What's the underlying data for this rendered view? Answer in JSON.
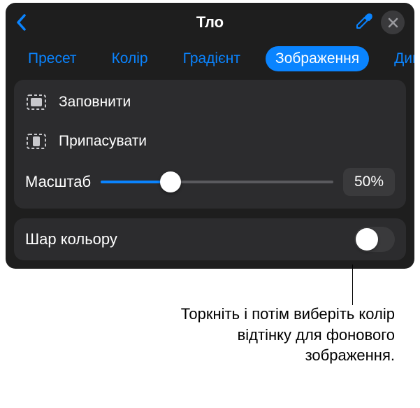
{
  "header": {
    "title": "Тло"
  },
  "tabs": {
    "items": [
      {
        "label": "Пресет"
      },
      {
        "label": "Колір"
      },
      {
        "label": "Градієнт"
      },
      {
        "label": "Зображення"
      },
      {
        "label": "Динамі"
      }
    ],
    "active_index": 3
  },
  "options": {
    "fill": "Заповнити",
    "fit": "Припасувати",
    "scale_label": "Масштаб",
    "scale_value": "50%",
    "scale_fraction": 0.3
  },
  "color_layer": {
    "label": "Шар кольору",
    "enabled": false
  },
  "callout": {
    "text": "Торкніть і потім виберіть колір відтінку для фонового зображення."
  },
  "icons": {
    "back": "chevron-left",
    "eyedropper": "eyedropper",
    "close": "xmark"
  },
  "colors": {
    "accent": "#0a84ff",
    "panel": "#1e1e1e",
    "group": "#2c2c2e"
  }
}
